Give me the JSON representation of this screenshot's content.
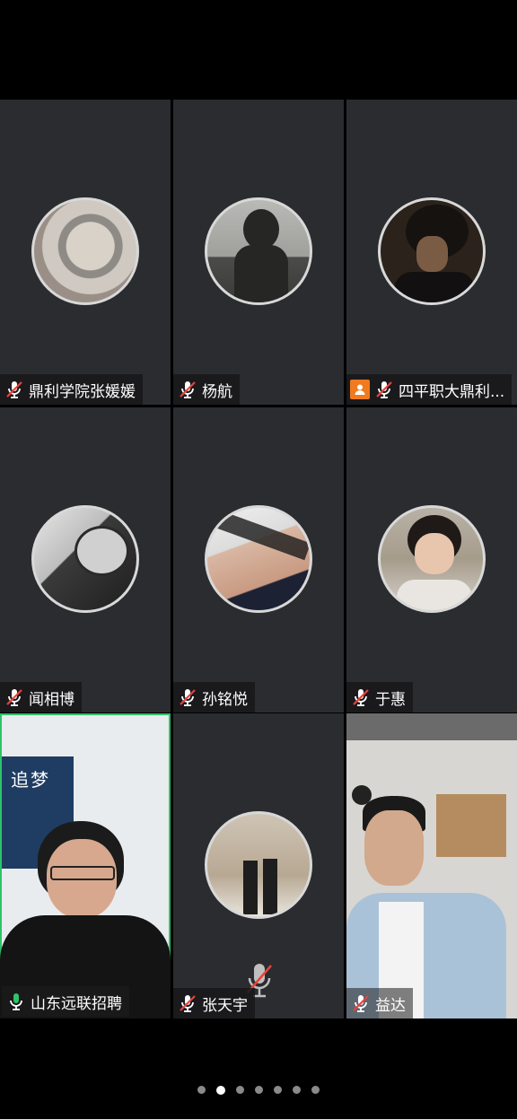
{
  "participants": [
    {
      "name": "鼎利学院张媛媛",
      "mic": "muted",
      "type": "avatar",
      "host": false
    },
    {
      "name": "杨航",
      "mic": "muted",
      "type": "avatar",
      "host": false
    },
    {
      "name": "四平职大鼎利...",
      "mic": "muted",
      "type": "avatar",
      "host": true
    },
    {
      "name": "闻相博",
      "mic": "muted",
      "type": "avatar",
      "host": false
    },
    {
      "name": "孙铭悦",
      "mic": "muted",
      "type": "avatar",
      "host": false
    },
    {
      "name": "于惠",
      "mic": "muted",
      "type": "avatar",
      "host": false
    },
    {
      "name": "山东远联招聘",
      "mic": "active",
      "type": "video",
      "speaking": true
    },
    {
      "name": "张天宇",
      "mic": "muted",
      "type": "avatar",
      "host": false
    },
    {
      "name": "益达",
      "mic": "muted",
      "type": "video",
      "host": false
    }
  ],
  "video_poster_text": "追梦",
  "pager": {
    "total": 7,
    "active_index": 1
  },
  "colors": {
    "tile_bg": "#2b2c2f",
    "speaking_border": "#2ec36a",
    "host_badge": "#f07a1f",
    "muted_red": "#e8433a",
    "mic_active_green": "#2ec36a"
  },
  "icons": {
    "mic_muted": "mic-muted-icon",
    "mic_active": "mic-icon",
    "host": "host-person-icon"
  }
}
